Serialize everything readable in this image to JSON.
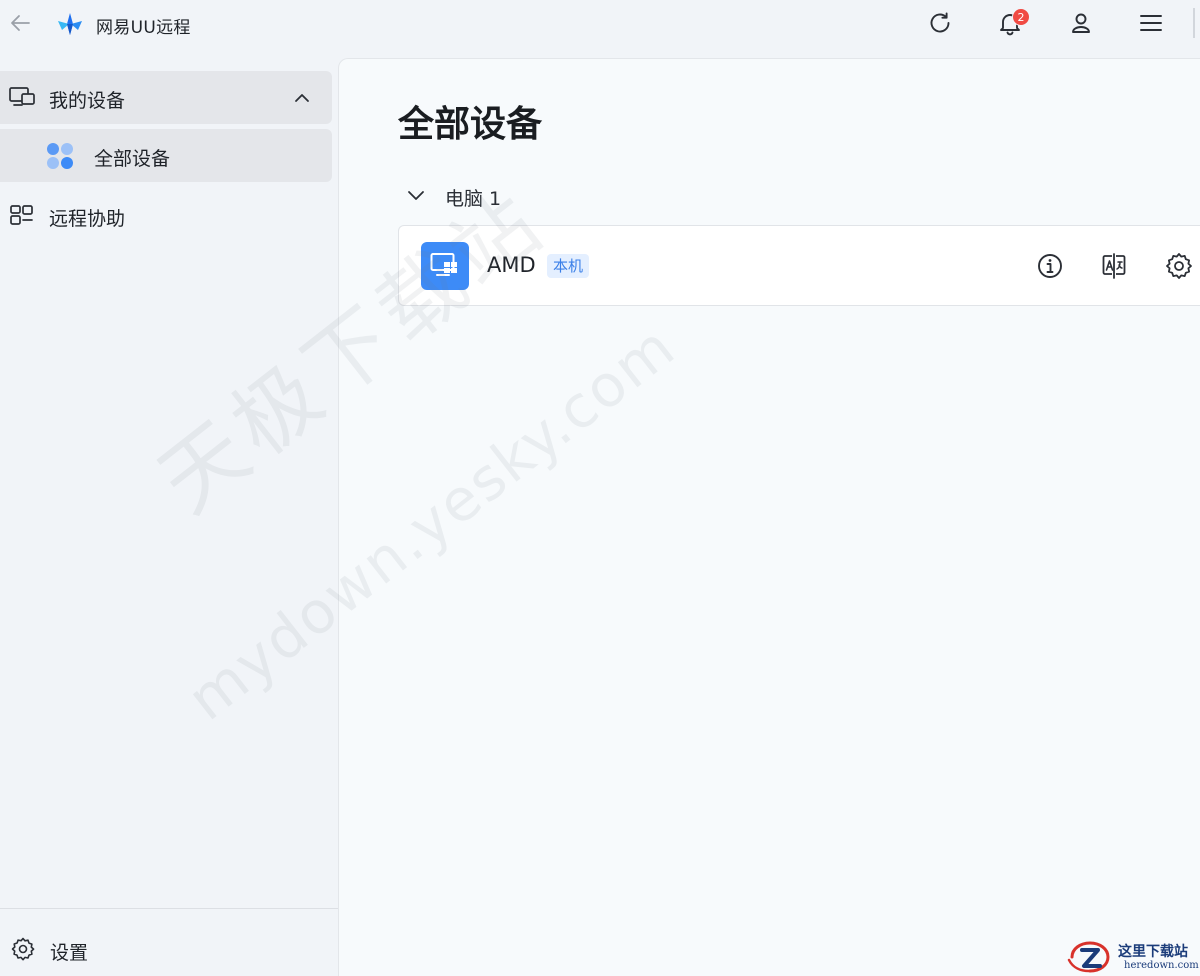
{
  "app": {
    "title": "网易UU远程"
  },
  "titlebar": {
    "notification_count": "2",
    "icons": [
      "back-arrow-icon",
      "refresh-icon",
      "bell-icon",
      "user-icon",
      "menu-icon"
    ]
  },
  "sidebar": {
    "group_label": "我的设备",
    "group_expanded": true,
    "sub_item_label": "全部设备",
    "remote_assist_label": "远程协助",
    "settings_label": "设置"
  },
  "main": {
    "page_title": "全部设备",
    "section": {
      "label": "电脑 1",
      "expanded": true
    },
    "device": {
      "name": "AMD",
      "tag": "本机",
      "actions": [
        "info-icon",
        "translate-icon",
        "gear-icon"
      ]
    }
  },
  "watermarks": {
    "main": "天极下载站",
    "sub": "mydown.yesky.com",
    "corner_title": "这里下载站",
    "corner_url": "heredown.com"
  },
  "colors": {
    "accent": "#3d8bf7",
    "badge": "#f04a43",
    "tag_bg": "#e4efff",
    "tag_text": "#3a7fe8",
    "sidebar_selected": "#e4e6ea"
  }
}
